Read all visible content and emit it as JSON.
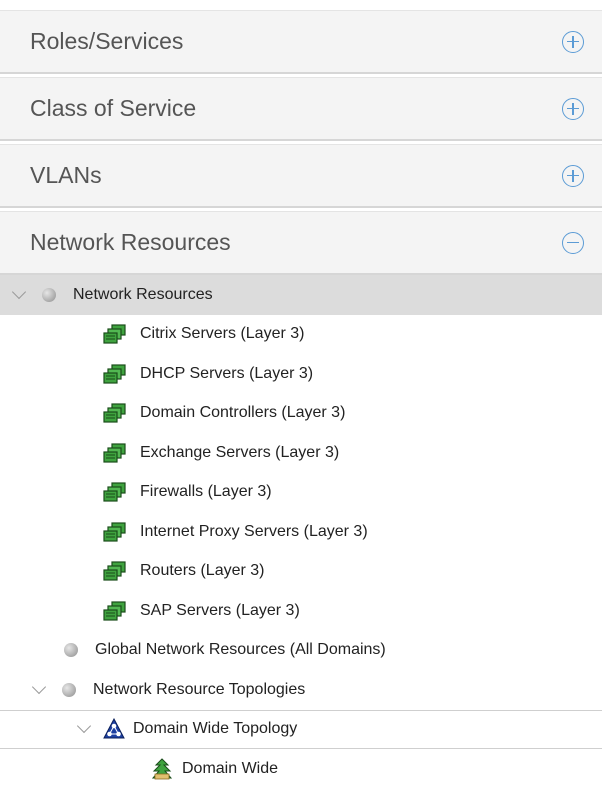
{
  "accordion": {
    "panels": [
      {
        "title": "Roles/Services",
        "state": "collapsed"
      },
      {
        "title": "Class of Service",
        "state": "collapsed"
      },
      {
        "title": "VLANs",
        "state": "collapsed"
      },
      {
        "title": "Network Resources",
        "state": "expanded"
      }
    ]
  },
  "tree": {
    "root": {
      "label": "Network Resources",
      "expanded": true,
      "selected": true
    },
    "children": [
      "Citrix Servers (Layer 3)",
      "DHCP Servers (Layer 3)",
      "Domain Controllers (Layer 3)",
      "Exchange Servers (Layer 3)",
      "Firewalls (Layer 3)",
      "Internet Proxy Servers (Layer 3)",
      "Routers (Layer 3)",
      "SAP Servers (Layer 3)"
    ],
    "global": {
      "label": "Global Network Resources (All Domains)"
    },
    "topologies": {
      "label": "Network Resource Topologies",
      "expanded": true,
      "child": {
        "label": "Domain Wide Topology",
        "expanded": true,
        "leaf": {
          "label": "Domain Wide"
        }
      }
    }
  },
  "colors": {
    "accent": "#5b9bd5",
    "icon_green": "#3fa33f",
    "selected_row": "#dcdcdc"
  }
}
